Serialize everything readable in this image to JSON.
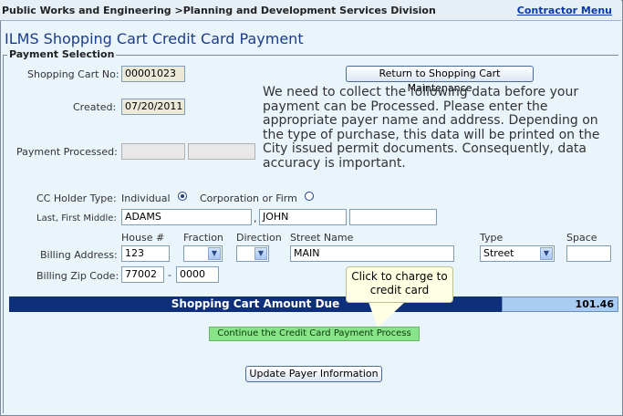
{
  "header": {
    "breadcrumb": "Public Works and Engineering >Planning and Development Services Division",
    "contractor_menu": "Contractor Menu"
  },
  "page_title": "ILMS Shopping Cart Credit Card Payment",
  "section_legend": "Payment Selection",
  "cart": {
    "number_label": "Shopping Cart No:",
    "number_value": "00001023",
    "created_label": "Created:",
    "created_value": "07/20/2011",
    "processed_label": "Payment Processed:",
    "processed_value_1": "",
    "processed_value_2": "",
    "return_button": "Return to Shopping Cart Maintenance"
  },
  "info_text": "We need to collect the following data before your payment can be Processed. Please enter the appropriate payer name and address. Depending on the type of purchase, this data will be printed on the City issued permit documents. Consequently, data accuracy is important.",
  "holder": {
    "type_label": "CC Holder Type:",
    "option_individual": "Individual",
    "option_corporation": "Corporation or Firm",
    "selected": "Individual",
    "name_label": "Last, First Middle:",
    "last_name": "ADAMS",
    "comma": ",",
    "first_name": "JOHN",
    "middle_name": ""
  },
  "address": {
    "col_house": "House #",
    "col_fraction": "Fraction",
    "col_direction": "Direction",
    "col_street": "Street Name",
    "col_type": "Type",
    "col_space": "Space",
    "billing_label": "Billing Address:",
    "house_value": "123",
    "fraction_value": "",
    "direction_value": "",
    "street_value": "MAIN",
    "type_value": "Street",
    "space_value": "",
    "zip_label": "Billing Zip Code:",
    "zip_value": "77002",
    "zip_dash": "-",
    "zip_ext": "0000"
  },
  "amount": {
    "label": "Shopping Cart Amount Due",
    "value": "101.46"
  },
  "tooltip": "Click to charge to credit card",
  "buttons": {
    "continue": "Continue the Credit Card Payment Process",
    "update": "Update Payer Information"
  }
}
